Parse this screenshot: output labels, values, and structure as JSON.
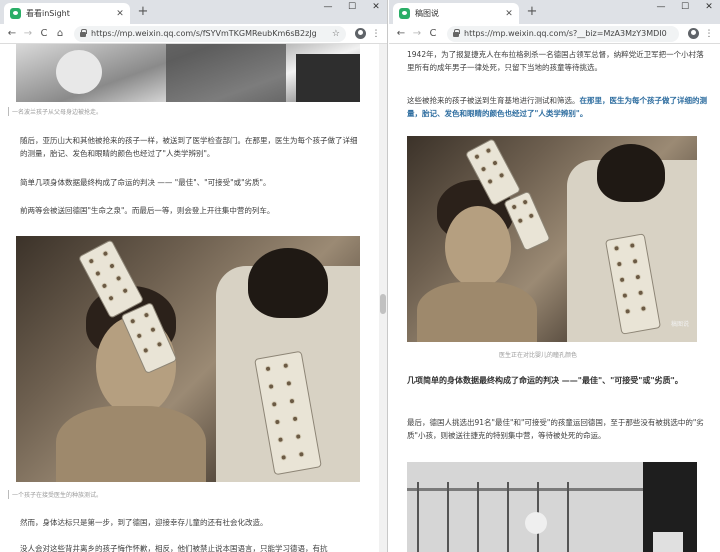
{
  "left": {
    "tab_title": "看看inSight",
    "url": "https://mp.weixin.qq.com/s/fSYVmTKGMReubKm6sB2zJg",
    "caption_top": "一名波兰孩子从父母身边被抢走。",
    "para1": "随后，亚历山大和其他被抢来的孩子一样，被送到了医学检查部门。在那里，医生为每个孩子做了详细的测量，胎记、发色和眼睛的颜色也经过了\"人类学辨别\"。",
    "para2": "简单几项身体数据最终构成了命运的判决 —— \"最佳\"、\"可接受\"或\"劣质\"。",
    "para3": "前两等会被送回德国\"生命之泉\"。而最后一等，则会登上开往集中营的列车。",
    "caption_photo": "一个孩子在接受医生的种族测试。",
    "para4": "然而，身体达标只是第一步，到了德国，迎接幸存儿童的还有社会化改造。",
    "para5": "没人会对这些背井离乡的孩子悔作怀歉，相反，他们被禁止说本国语言，只能学习德语，有抗"
  },
  "right": {
    "tab_title": "稿图说",
    "url": "https://mp.weixin.qq.com/s?__biz=MzA3MzY3MDI0",
    "para1": "1942年，为了报复捷克人在布拉格刺杀一名德国占领军总督，纳粹党近卫军把一个小村落里所有的成年男子一律处死，只留下当地的孩童等待挑选。",
    "para2_plain": "这些被抢来的孩子被送到生育基地进行测试和筛选。",
    "para2_highlight": "在那里，医生为每个孩子做了详细的测量，胎记、发色和眼睛的颜色也经过了\"人类学辨别\"。",
    "watermark": "稿图说",
    "caption_photo": "医生正在对比婴儿的瞳孔颜色",
    "bold_para": "几项简单的身体数据最终构成了命运的判决 ——\"最佳\"、\"可接受\"或\"劣质\"。",
    "para3": "最后，德国人挑选出91名\"最佳\"和\"可接受\"的孩童运回德国，至于那些没有被挑选中的\"劣质\"小孩，则被送往捷克的特别集中营，等待被处死的命运。"
  },
  "window_controls": [
    "—",
    "☐",
    "✕"
  ],
  "icons": {
    "back": "back-arrow-icon",
    "forward": "forward-arrow-icon",
    "reload": "reload-icon",
    "home": "home-icon",
    "star": "star-icon",
    "menu": "more-menu-icon"
  },
  "colors": {
    "tabstrip": "#dee1e6",
    "highlight_text": "#2f6ea0",
    "wechat_green": "#2aae67"
  }
}
